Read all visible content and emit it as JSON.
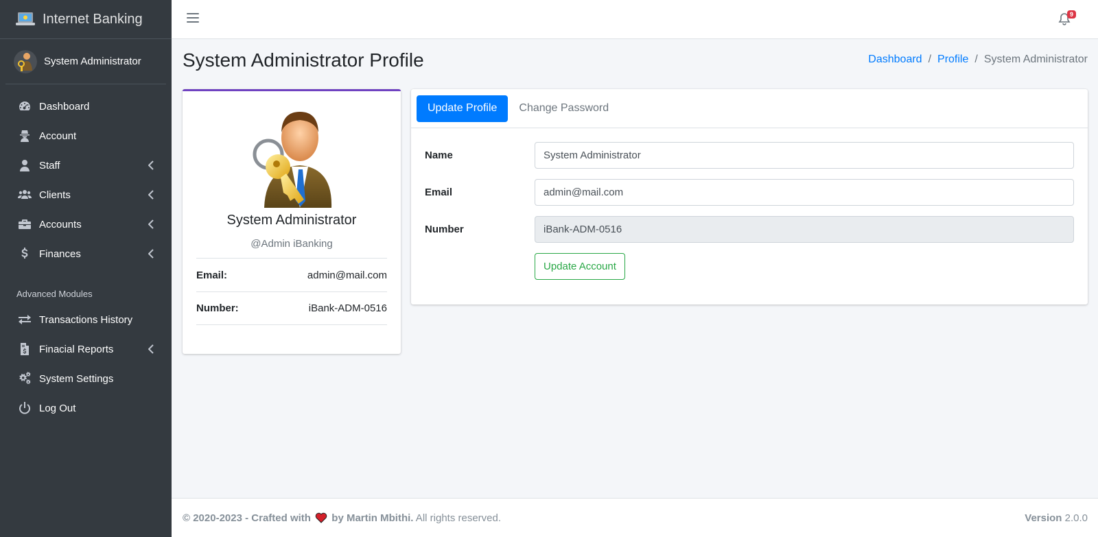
{
  "brand": {
    "title": "Internet Banking",
    "logo_icon": "laptop-icon"
  },
  "user_panel": {
    "name": "System Administrator",
    "avatar_icon": "admin-key-avatar"
  },
  "sidebar": {
    "items": [
      {
        "label": "Dashboard",
        "icon": "tachometer-icon",
        "has_caret": false
      },
      {
        "label": "Account",
        "icon": "user-secret-icon",
        "has_caret": false
      },
      {
        "label": "Staff",
        "icon": "user-tie-icon",
        "has_caret": true
      },
      {
        "label": "Clients",
        "icon": "users-icon",
        "has_caret": true
      },
      {
        "label": "Accounts",
        "icon": "briefcase-icon",
        "has_caret": true
      },
      {
        "label": "Finances",
        "icon": "dollar-icon",
        "has_caret": true
      }
    ],
    "section_header": "Advanced Modules",
    "advanced_items": [
      {
        "label": "Transactions History",
        "icon": "exchange-icon",
        "has_caret": false
      },
      {
        "label": "Finacial Reports",
        "icon": "file-invoice-dollar-icon",
        "has_caret": true
      },
      {
        "label": "System Settings",
        "icon": "cogs-icon",
        "has_caret": false
      },
      {
        "label": "Log Out",
        "icon": "power-off-icon",
        "has_caret": false
      }
    ]
  },
  "topbar": {
    "notification_count": "9"
  },
  "header": {
    "title": "System Administrator Profile",
    "breadcrumb": {
      "item1": "Dashboard",
      "item2": "Profile",
      "item3": "System Administrator",
      "separator": "/"
    }
  },
  "profile": {
    "name": "System Administrator",
    "handle": "@Admin iBanking",
    "email_label": "Email:",
    "email": "admin@mail.com",
    "number_label": "Number:",
    "number": "iBank-ADM-0516"
  },
  "tabs": {
    "active": "Update Profile",
    "inactive": "Change Password"
  },
  "form": {
    "name_label": "Name",
    "name_value": "System Administrator",
    "email_label": "Email",
    "email_value": "admin@mail.com",
    "number_label": "Number",
    "number_value": "iBank-ADM-0516",
    "submit_label": "Update Account"
  },
  "footer": {
    "copyright_bold": "© 2020-2023 - Crafted with",
    "author_bold": "by Martin Mbithi.",
    "rights": " All rights reserved.",
    "version_label": "Version",
    "version_value": " 2.0.0"
  },
  "colors": {
    "sidebar_bg": "#343a40",
    "primary": "#007bff",
    "success": "#28a745",
    "card_accent": "#6f42c1",
    "badge": "#dc3545"
  }
}
